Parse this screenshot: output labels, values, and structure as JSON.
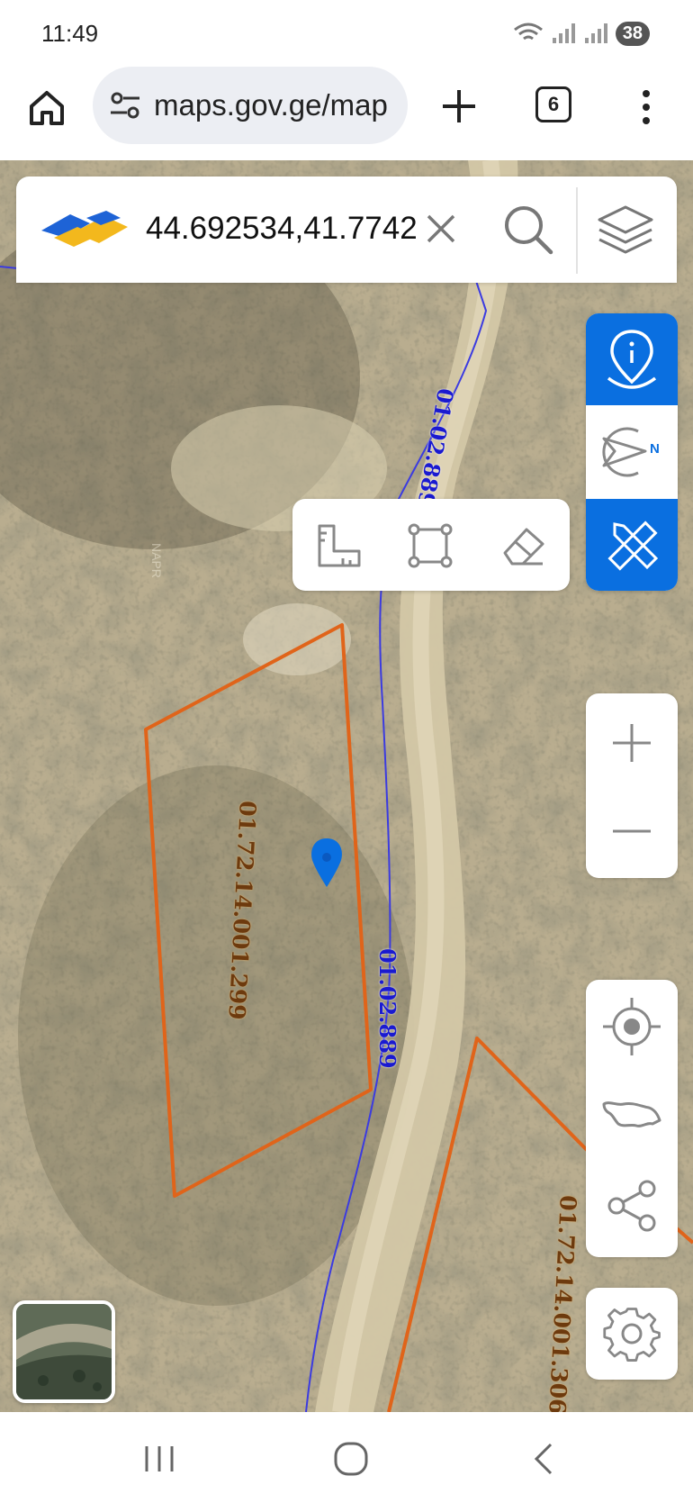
{
  "status_bar": {
    "time": "11:49",
    "battery": "38"
  },
  "browser": {
    "url": "maps.gov.ge/map",
    "tab_count": "6"
  },
  "search": {
    "query": "44.692534,41.7742"
  },
  "map": {
    "parcel_labels": [
      "01.72.14.001.299",
      "01.72.14.001.306"
    ],
    "road_label": "01.02.889",
    "faint_label": "NAPR"
  },
  "colors": {
    "accent": "#0a6fe0",
    "parcel_outline": "#e0641a",
    "road_line": "#3b3be0"
  },
  "icons": {
    "home": "home-icon",
    "site_info": "tune-icon",
    "new_tab": "plus-icon",
    "menu": "kebab-icon",
    "clear": "close-icon",
    "search": "search-icon",
    "layers": "layers-icon",
    "info": "info-location-icon",
    "direction": "compass-north-icon",
    "draw": "pencil-ruler-icon",
    "measure": "ruler-icon",
    "area": "polygon-icon",
    "erase": "eraser-icon",
    "zoom_in": "plus-icon",
    "zoom_out": "minus-icon",
    "locate": "my-location-icon",
    "country": "georgia-outline-icon",
    "share": "share-icon",
    "settings": "gear-icon"
  }
}
